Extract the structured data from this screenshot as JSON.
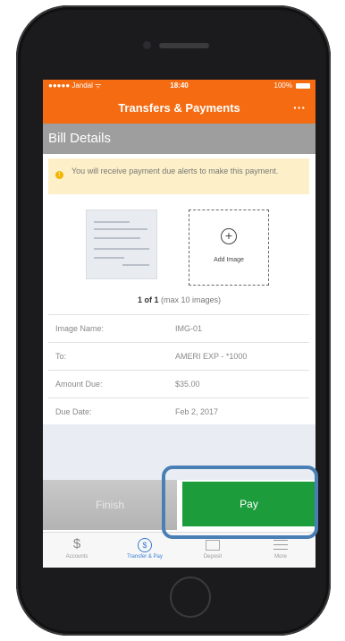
{
  "status_bar": {
    "carrier": "●●●●● Jandal ᯤ",
    "time": "18:40",
    "battery": "100%"
  },
  "header": {
    "title": "Transfers & Payments",
    "more_label": "···"
  },
  "section": {
    "title": "Bill Details"
  },
  "alert": {
    "icon": "info-icon",
    "text": "You will receive payment due alerts to make this payment."
  },
  "images": {
    "add_label": "Add Image",
    "count_bold": "1 of 1",
    "count_rest": "(max 10 images)"
  },
  "details": [
    {
      "label": "Image Name:",
      "value": "IMG-01"
    },
    {
      "label": "To:",
      "value": "AMERI EXP - *1000"
    },
    {
      "label": "Amount Due:",
      "value": "$35.00"
    },
    {
      "label": "Due Date:",
      "value": "Feb 2, 2017"
    }
  ],
  "actions": {
    "finish_label": "Finish",
    "pay_label": "Pay"
  },
  "tabs": [
    {
      "label": "Accounts",
      "icon": "dollar-icon",
      "glyph": "$",
      "active": false
    },
    {
      "label": "Transfer & Pay",
      "icon": "transfer-pay-icon",
      "glyph": "$",
      "active": true
    },
    {
      "label": "Deposit",
      "icon": "deposit-icon",
      "glyph": "",
      "active": false
    },
    {
      "label": "More",
      "icon": "menu-icon",
      "glyph": "",
      "active": false
    }
  ],
  "colors": {
    "brand_orange": "#f46b11",
    "pay_green": "#1c9c3a",
    "highlight_blue": "#4a7fb5",
    "active_tab": "#3b7dd8"
  }
}
